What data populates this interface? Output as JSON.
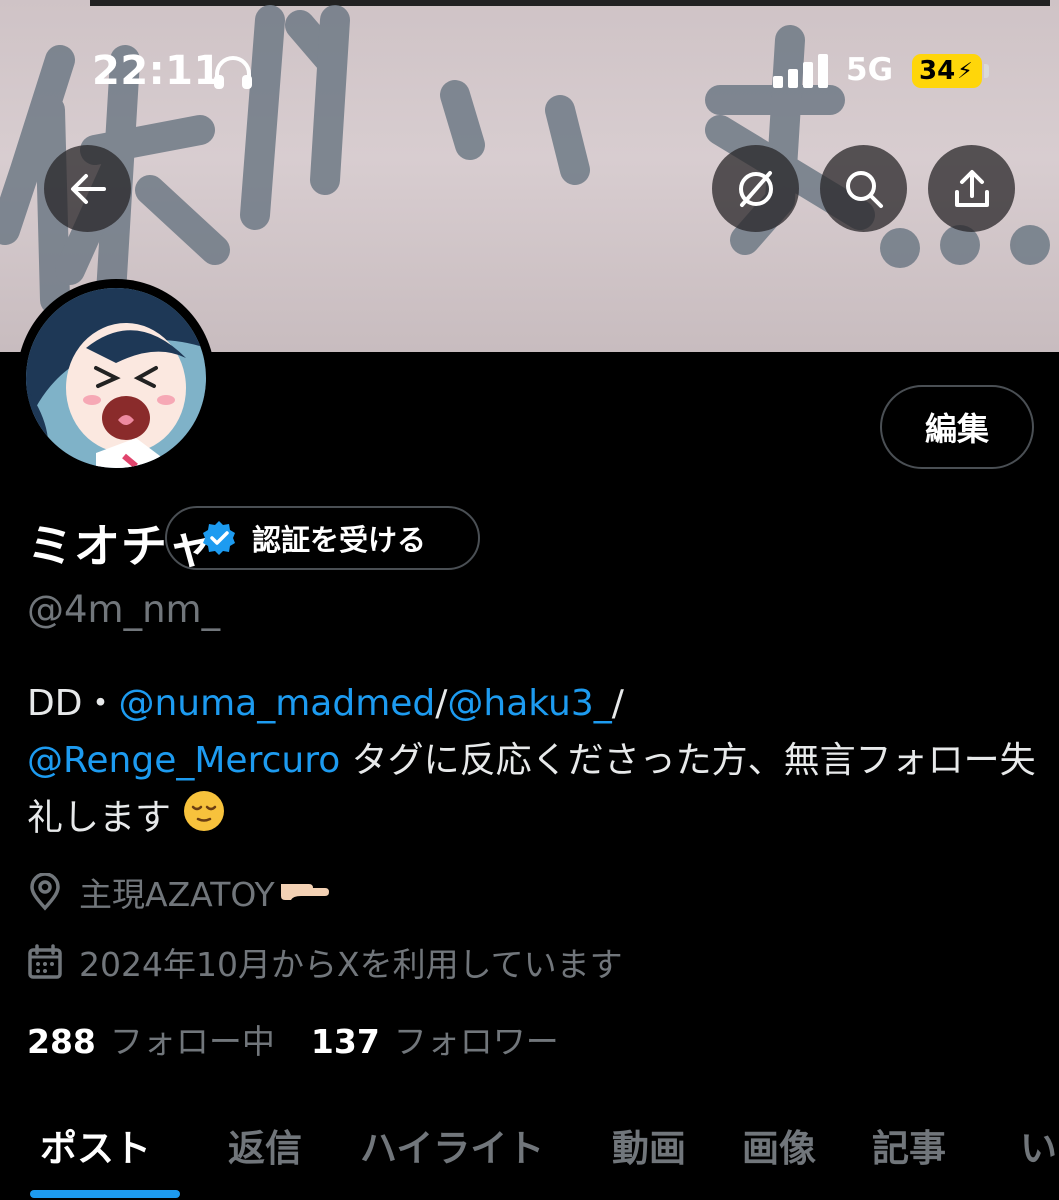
{
  "status_bar": {
    "time": "22:11",
    "network": "5G",
    "battery": "34"
  },
  "profile": {
    "name": "ミオチャ",
    "verify_label": "認証を受ける",
    "handle": "@4m_nm_",
    "edit_label": "編集",
    "bio": {
      "prefix": "DD・",
      "mention_1": "@numa_madmed",
      "sep_1": "/",
      "mention_2": "@haku3_",
      "sep_2": "/",
      "mention_3": "@Renge_Mercuro",
      "suffix": " タグに反応くださった方、無言フォロー失礼します"
    },
    "location": "主現AZATOY",
    "joined": "2024年10月からXを利用しています",
    "following_count": "288",
    "following_label": "フォロー中",
    "followers_count": "137",
    "followers_label": "フォロワー"
  },
  "tabs": [
    {
      "label": "ポスト",
      "active": true
    },
    {
      "label": "返信"
    },
    {
      "label": "ハイライト"
    },
    {
      "label": "動画"
    },
    {
      "label": "画像"
    },
    {
      "label": "記事"
    },
    {
      "label": "い"
    }
  ],
  "icons": {
    "back": "arrow-left-icon",
    "grok": "grok-icon",
    "search": "search-icon",
    "share": "share-icon",
    "verified": "verified-badge-icon",
    "location": "location-pin-icon",
    "calendar": "calendar-icon"
  },
  "colors": {
    "accent": "#1d9bf0",
    "background": "#000000",
    "muted": "#71767b",
    "battery": "#ffd60a"
  }
}
